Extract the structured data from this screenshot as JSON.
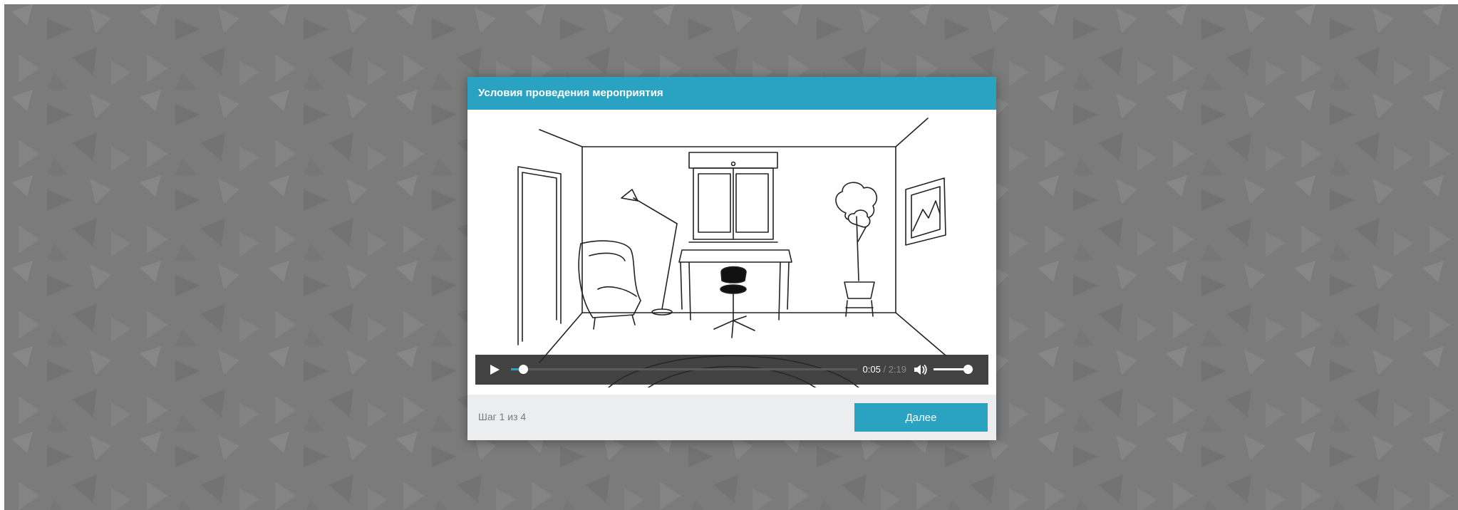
{
  "colors": {
    "backdrop": "#7b7b7b",
    "accent": "#2aa3c3",
    "footer": "#ecedef",
    "control_bar": "#282828"
  },
  "dialog": {
    "title": "Условия проведения мероприятия"
  },
  "video": {
    "illustration": "room-with-desk-chair-lamp-armchair-plant-picture",
    "progress": 0.036,
    "current_time": "0:05",
    "separator": " / ",
    "duration": "2:19",
    "volume": 0.85,
    "play_icon": "play-icon",
    "volume_icon": "speaker-icon"
  },
  "footer": {
    "step_text": "Шаг 1 из 4",
    "next_label": "Далее"
  }
}
